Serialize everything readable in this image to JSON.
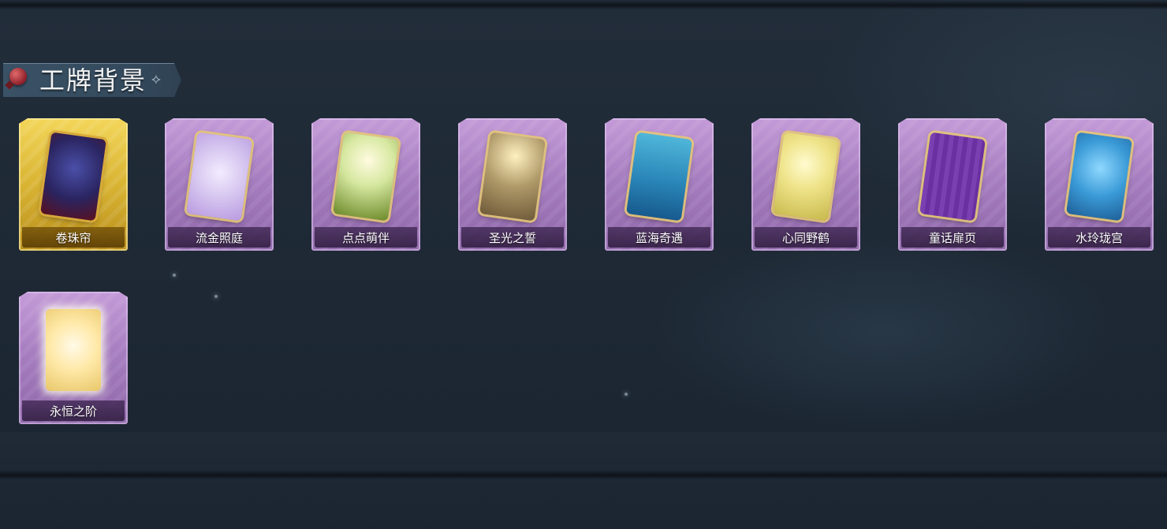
{
  "section": {
    "title": "工牌背景"
  },
  "cards": [
    {
      "label": "卷珠帘",
      "rarity": "gold",
      "art_icon": "curtain-card-icon"
    },
    {
      "label": "流金照庭",
      "rarity": "purple",
      "art_icon": "golden-frame-card-icon"
    },
    {
      "label": "点点萌伴",
      "rarity": "purple",
      "art_icon": "meadow-card-icon"
    },
    {
      "label": "圣光之誓",
      "rarity": "purple",
      "art_icon": "holy-light-card-icon"
    },
    {
      "label": "蓝海奇遇",
      "rarity": "purple",
      "art_icon": "ocean-card-icon"
    },
    {
      "label": "心同野鹤",
      "rarity": "purple",
      "art_icon": "crane-card-icon"
    },
    {
      "label": "童话扉页",
      "rarity": "purple",
      "art_icon": "fairytale-page-card-icon"
    },
    {
      "label": "水玲珑宫",
      "rarity": "purple",
      "art_icon": "water-palace-card-icon"
    },
    {
      "label": "永恒之阶",
      "rarity": "purple",
      "art_icon": "eternal-steps-card-icon"
    }
  ],
  "colors": {
    "background": "#1c2632",
    "gold_frame": "#d9b433",
    "purple_frame": "#a77ec0",
    "header_banner": "#34495c",
    "pin": "#8e1f2a"
  }
}
